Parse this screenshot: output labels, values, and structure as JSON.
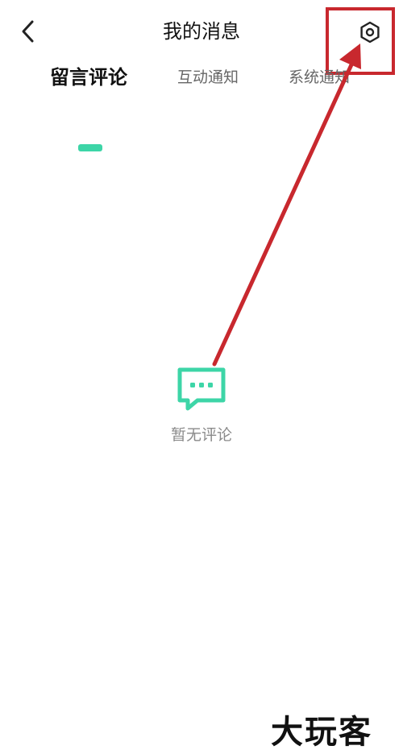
{
  "header": {
    "title": "我的消息",
    "back_icon": "chevron-left-icon",
    "settings_icon": "settings-hexagon-icon"
  },
  "tabs": [
    {
      "label": "留言评论",
      "active": true
    },
    {
      "label": "互动通知",
      "active": false
    },
    {
      "label": "系统通知",
      "active": false
    }
  ],
  "empty_state": {
    "icon": "comment-bubble-icon",
    "text": "暂无评论"
  },
  "annotation": {
    "highlight_color": "#c8282e",
    "target": "settings-button"
  },
  "watermark": {
    "text": "大玩客"
  },
  "colors": {
    "accent": "#3dd5a7",
    "annotation": "#c8282e"
  }
}
